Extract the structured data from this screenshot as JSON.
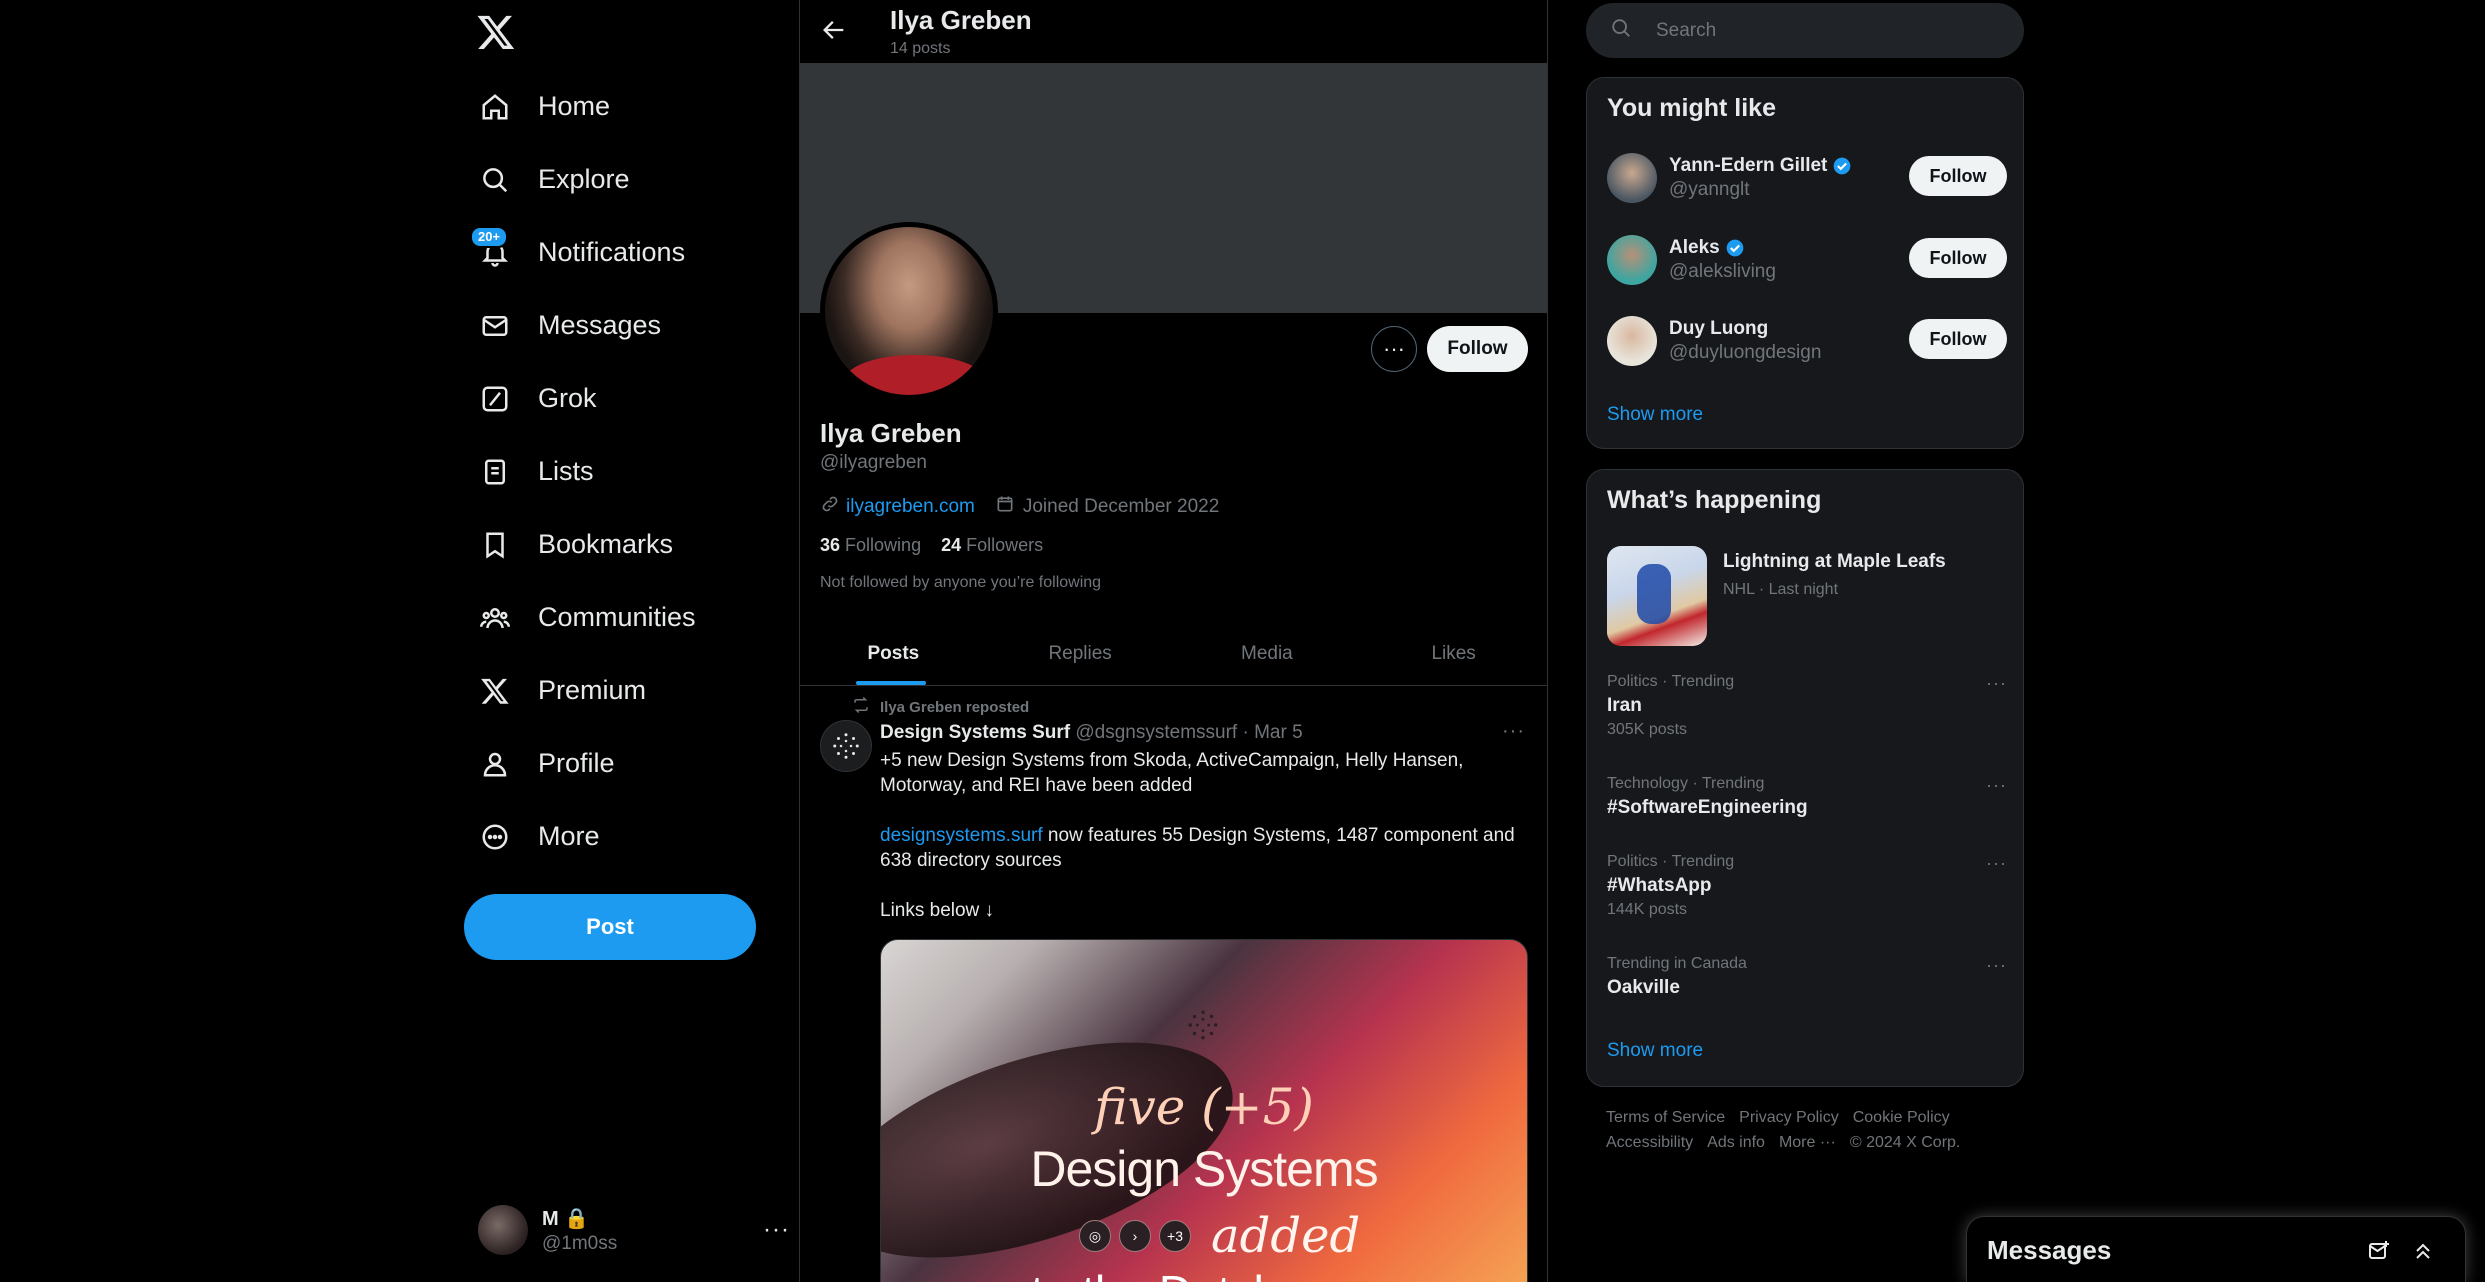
{
  "nav": {
    "items": [
      {
        "label": "Home"
      },
      {
        "label": "Explore"
      },
      {
        "label": "Notifications"
      },
      {
        "label": "Messages"
      },
      {
        "label": "Grok"
      },
      {
        "label": "Lists"
      },
      {
        "label": "Bookmarks"
      },
      {
        "label": "Communities"
      },
      {
        "label": "Premium"
      },
      {
        "label": "Profile"
      },
      {
        "label": "More"
      }
    ],
    "notifications_badge": "20+",
    "post_label": "Post",
    "account": {
      "name": "M",
      "handle": "@1m0ss",
      "more": "···"
    }
  },
  "header": {
    "name": "Ilya Greben",
    "posts_count": "14 posts"
  },
  "profile": {
    "name": "Ilya Greben",
    "handle": "@ilyagreben",
    "website": "ilyagreben.com",
    "joined": "Joined December 2022",
    "following_count": "36",
    "following_label": "Following",
    "followers_count": "24",
    "followers_label": "Followers",
    "note": "Not followed by anyone you’re following",
    "follow_label": "Follow",
    "more_label": "···"
  },
  "tabs": [
    {
      "label": "Posts"
    },
    {
      "label": "Replies"
    },
    {
      "label": "Media"
    },
    {
      "label": "Likes"
    }
  ],
  "post": {
    "repost_by": "Ilya Greben reposted",
    "author": "Design Systems Surf",
    "meta": "@dsgnsystemssurf · Mar 5",
    "dots": "···",
    "line1": "+5 new Design Systems from Skoda, ActiveCampaign, Helly Hansen, Motorway, and REI have been added",
    "link": "designsystems.surf",
    "line2": " now features 55 Design Systems, 1487 component and 638 directory sources",
    "line3": "Links below ↓",
    "media": {
      "five": "five (+5)",
      "ds": "Design Systems",
      "chip3": "+3",
      "added": "added",
      "dutch": "to the Dutch"
    }
  },
  "search": {
    "placeholder": "Search"
  },
  "suggestions": {
    "title": "You might like",
    "items": [
      {
        "name": "Yann-Edern Gillet",
        "handle": "@yannglt",
        "button": "Follow",
        "color": "#6b7b8c"
      },
      {
        "name": "Aleks",
        "handle": "@aleksliving",
        "button": "Follow",
        "color": "#3fa5a0"
      },
      {
        "name": "Duy Luong",
        "handle": "@duyluongdesign",
        "button": "Follow",
        "color": "#e8e4da"
      }
    ],
    "show_more": "Show more"
  },
  "happening": {
    "title": "What’s happening",
    "feature": {
      "title": "Lightning at Maple Leafs",
      "sub": "NHL · Last night"
    },
    "trends": [
      {
        "context": "Politics · Trending",
        "title": "Iran",
        "count": "305K posts"
      },
      {
        "context": "Technology · Trending",
        "title": "#SoftwareEngineering",
        "count": ""
      },
      {
        "context": "Politics · Trending",
        "title": "#WhatsApp",
        "count": "144K posts"
      },
      {
        "context": "Trending in Canada",
        "title": "Oakville",
        "count": ""
      }
    ],
    "dots": "···",
    "show_more": "Show more"
  },
  "footer": {
    "links": [
      "Terms of Service",
      "Privacy Policy",
      "Cookie Policy",
      "Accessibility",
      "Ads info",
      "More ···",
      "© 2024 X Corp."
    ]
  },
  "drawer": {
    "title": "Messages"
  },
  "colors": {
    "accent": "#1d9bf0",
    "background": "#000000",
    "card": "#16181c",
    "muted": "#71767b"
  }
}
